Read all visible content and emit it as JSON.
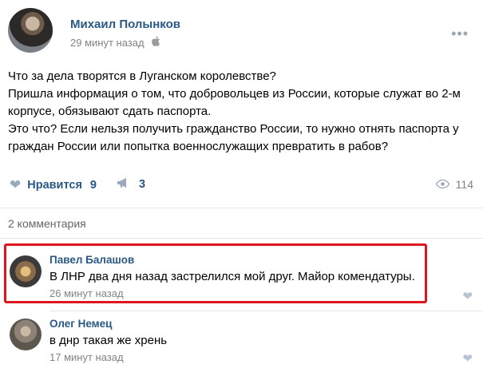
{
  "post": {
    "author": "Михаил Полынков",
    "time": "29 минут назад",
    "platform_icon": "apple-icon",
    "text_lines": [
      "Что за дела творятся в Луганском королевстве?",
      "Пришла информация о том, что добровольцев из России, которые служат во 2-м",
      "корпусе, обязывают сдать паспорта.",
      "Это что? Если нельзя получить гражданство России, то нужно отнять паспорта у",
      "граждан России или попытка военнослужащих превратить в рабов?"
    ],
    "likes_label": "Нравится",
    "likes_count": "9",
    "shares_count": "3",
    "views_count": "114"
  },
  "comments_header": "2 комментария",
  "comments": [
    {
      "author": "Павел Балашов",
      "text": "В ЛНР два дня назад застрелился мой друг. Майор комендатуры.",
      "time": "26 минут назад",
      "highlighted": true
    },
    {
      "author": "Олег Немец",
      "text": "в днр такая же хрень",
      "time": "17 минут назад",
      "highlighted": false
    }
  ],
  "colors": {
    "link": "#2a5885",
    "muted": "#828282",
    "highlight_border": "#e0141e",
    "divider": "#e7e8ec"
  }
}
